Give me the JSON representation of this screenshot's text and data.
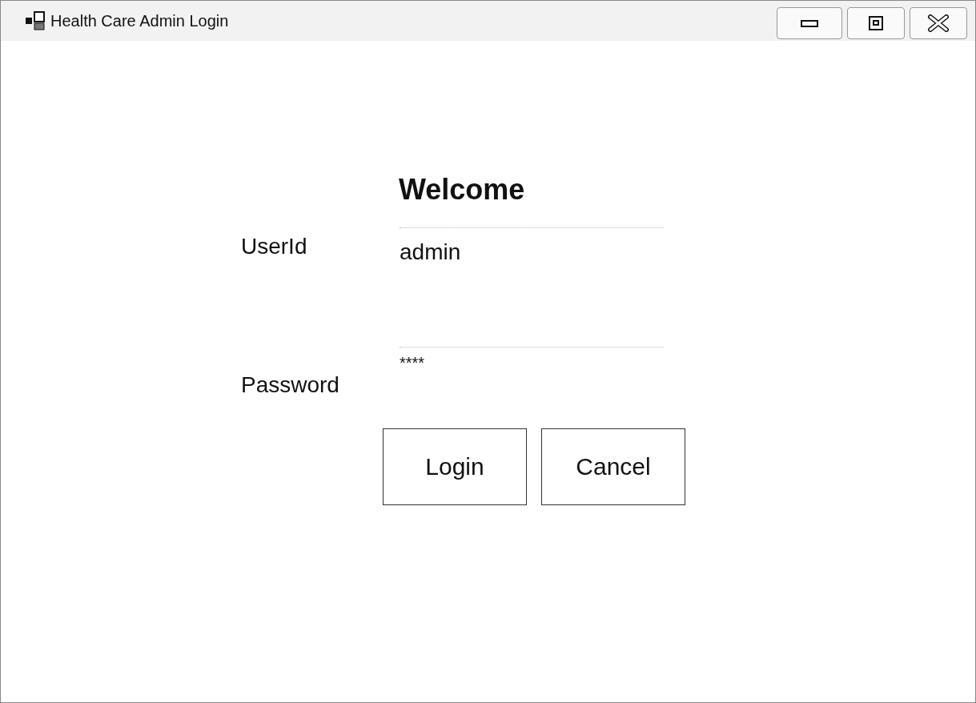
{
  "window": {
    "title": "Health Care Admin Login"
  },
  "heading": "Welcome",
  "fields": [
    {
      "label": "UserId",
      "value": "admin",
      "kind": "text"
    },
    {
      "label": "Password",
      "value": "****",
      "kind": "password"
    }
  ],
  "buttons": [
    "Login",
    "Cancel"
  ]
}
